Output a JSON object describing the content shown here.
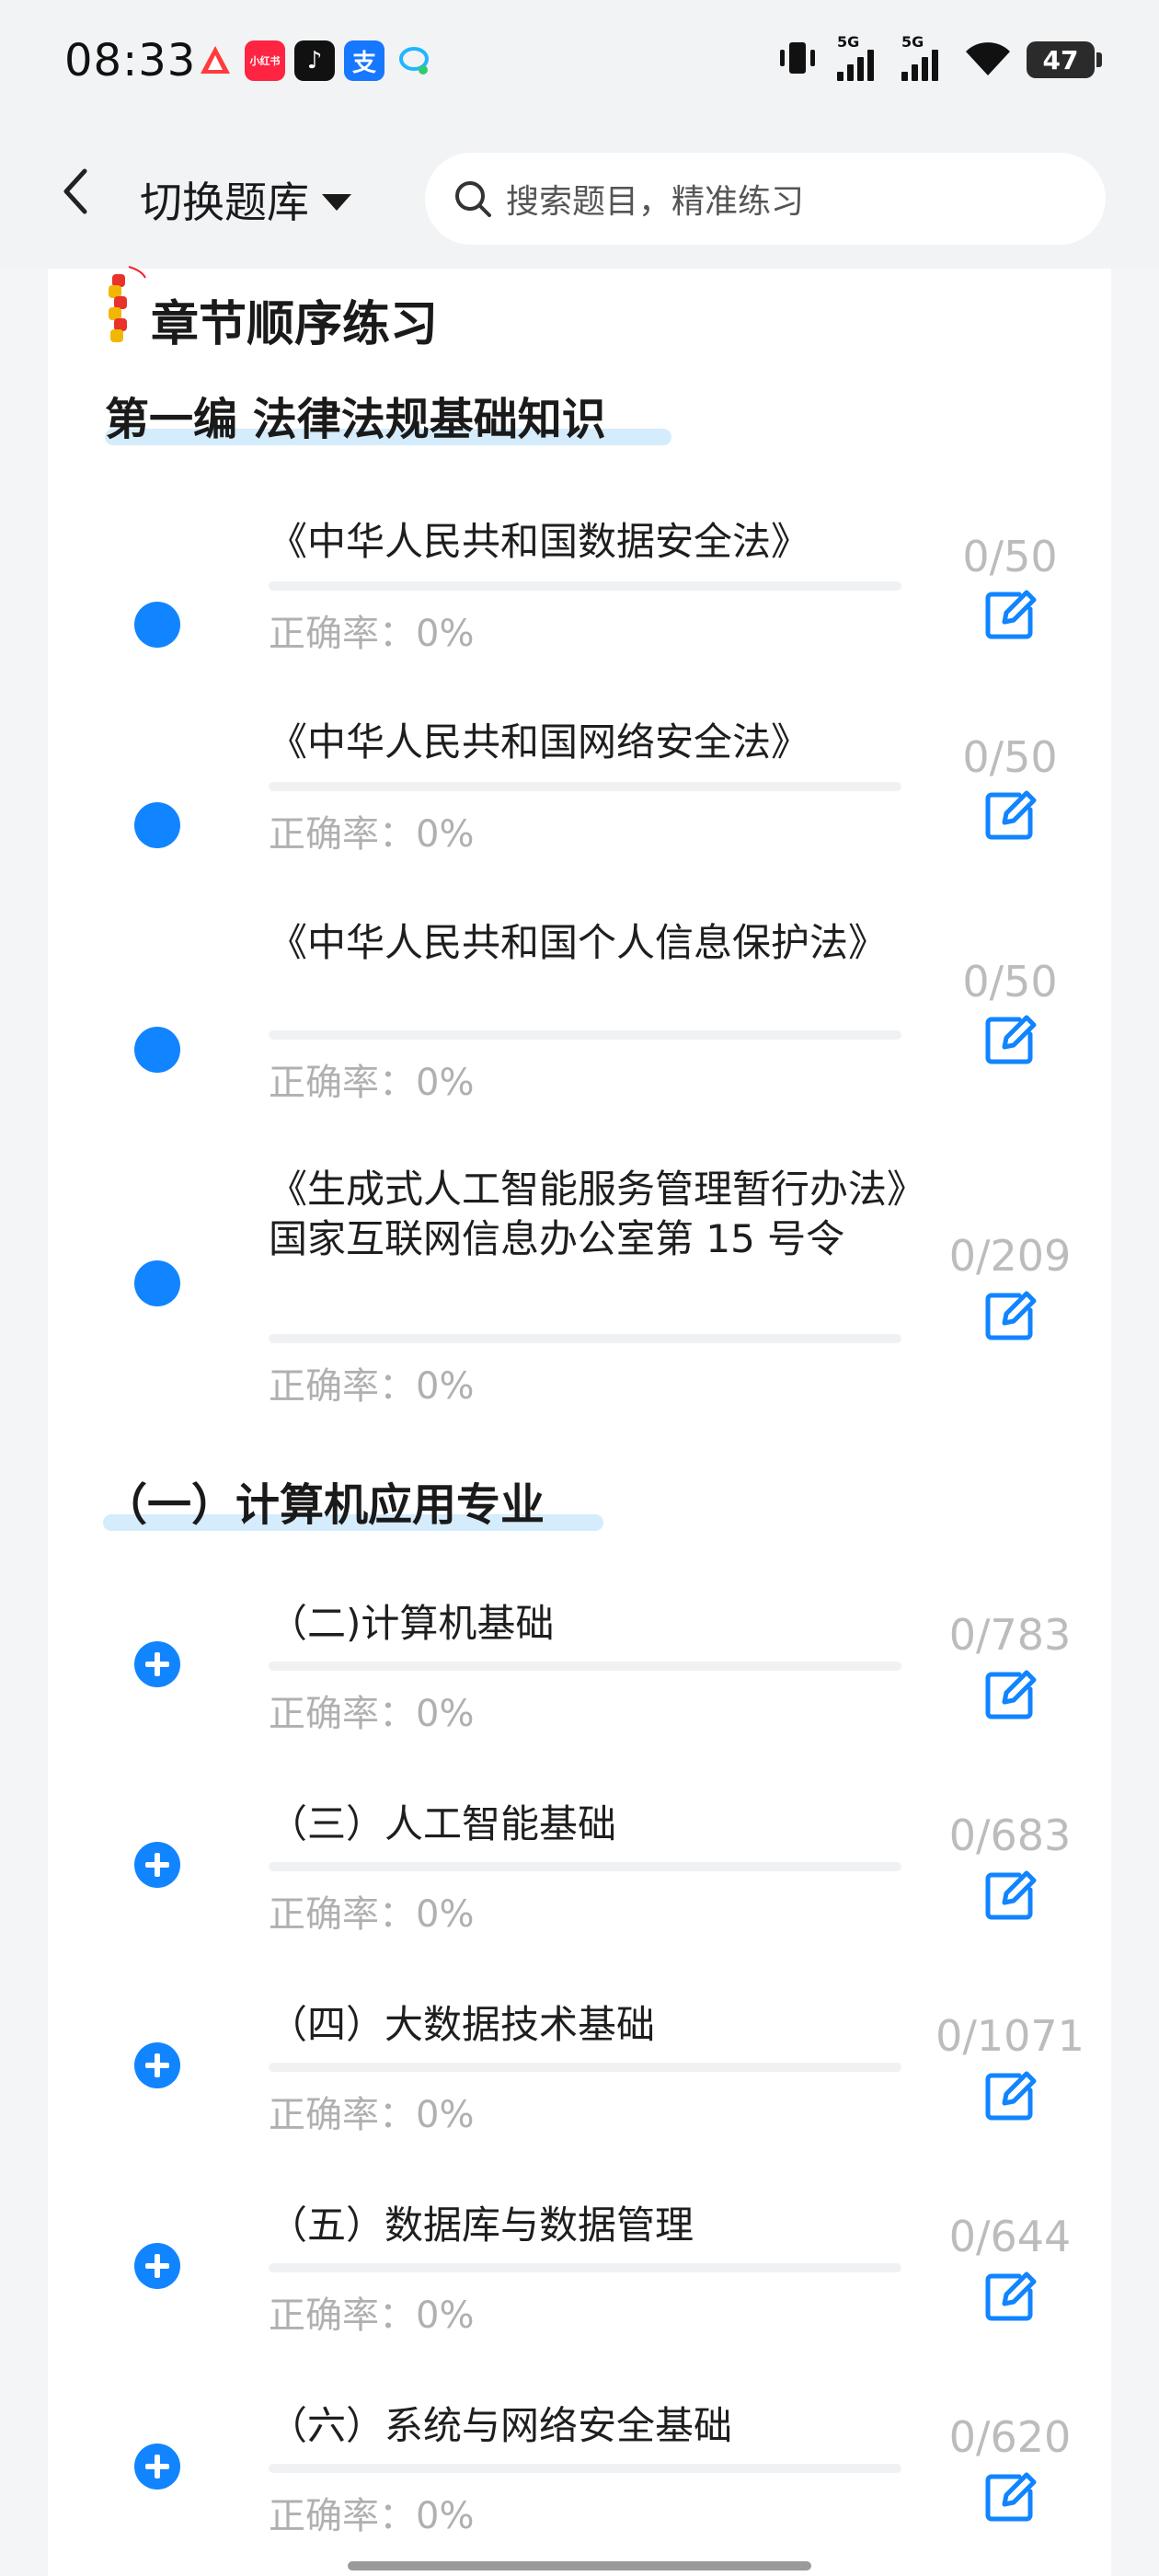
{
  "status_bar": {
    "time": "08:33",
    "apps": [
      {
        "name": "app-icon-1",
        "label": "",
        "color": "#ffffff"
      },
      {
        "name": "xiaohongshu-icon",
        "label": "小红书",
        "color": "#ff2442"
      },
      {
        "name": "tiktok-icon",
        "label": "♪",
        "color": "#111111"
      },
      {
        "name": "alipay-icon",
        "label": "支",
        "color": "#1677ff"
      },
      {
        "name": "chat-bubble-icon",
        "label": "",
        "color": "#ffffff"
      }
    ],
    "signal_labels": [
      "5G",
      "5G"
    ],
    "battery": "47"
  },
  "header": {
    "switch_label": "切换题库",
    "search_placeholder": "搜索题目，精准练习"
  },
  "section": {
    "title": "章节顺序练习"
  },
  "groups": [
    {
      "title": "第一编 法律法规基础知识",
      "items": [
        {
          "name": "《中华人民共和国数据安全法》",
          "accuracy": "正确率：0%",
          "count": "0/50"
        },
        {
          "name": "《中华人民共和国网络安全法》",
          "accuracy": "正确率：0%",
          "count": "0/50"
        },
        {
          "name": "《中华人民共和国个人信息保护法》",
          "accuracy": "正确率：0%",
          "count": "0/50"
        },
        {
          "name": "《生成式人工智能服务管理暂行办法》国家互联网信息办公室第 15 号令",
          "accuracy": "正确率：0%",
          "count": "0/209"
        }
      ]
    },
    {
      "title": "（一）计算机应用专业",
      "items": [
        {
          "name": "（二)计算机基础",
          "accuracy": "正确率：0%",
          "count": "0/783"
        },
        {
          "name": "（三）人工智能基础",
          "accuracy": "正确率：0%",
          "count": "0/683"
        },
        {
          "name": "（四）大数据技术基础",
          "accuracy": "正确率：0%",
          "count": "0/1071"
        },
        {
          "name": "（五）数据库与数据管理",
          "accuracy": "正确率：0%",
          "count": "0/644"
        },
        {
          "name": "（六）系统与网络安全基础",
          "accuracy": "正确率：0%",
          "count": "0/620"
        }
      ]
    }
  ],
  "colors": {
    "accent": "#1184ff",
    "highlight": "#d4ecfb",
    "muted": "#b0b0b0"
  }
}
